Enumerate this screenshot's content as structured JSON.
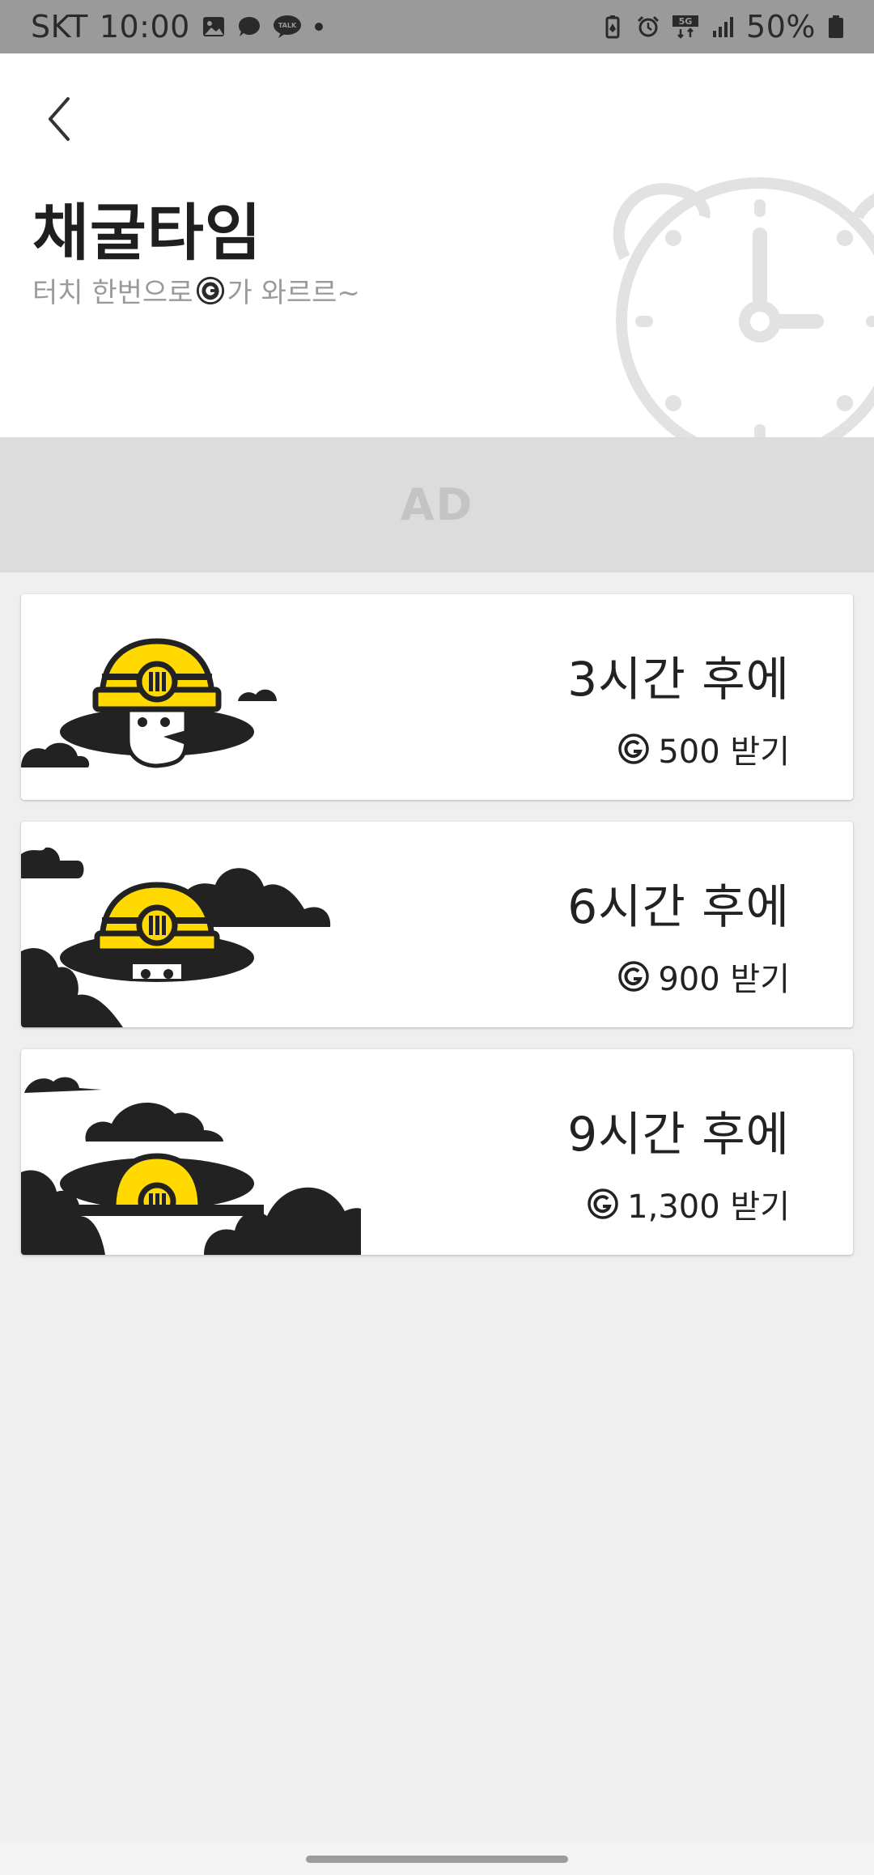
{
  "status_bar": {
    "carrier": "SKT",
    "time": "10:00",
    "battery": "50%",
    "network": "5G",
    "icons_left": [
      "gallery-icon",
      "chat-bubble-icon",
      "kakaotalk-icon",
      "dot-icon"
    ],
    "icons_right": [
      "battery-saver-icon",
      "alarm-icon",
      "5g-icon",
      "signal-icon",
      "battery-icon"
    ]
  },
  "header": {
    "title": "채굴타임",
    "subtitle_before": "터치 한번으로 ",
    "subtitle_after": "가 와르르~",
    "coin_icon": "g-coin-icon",
    "background_icon": "alarm-clock-icon"
  },
  "ad": {
    "label": "AD"
  },
  "cards": [
    {
      "time": "3시간 후에",
      "reward": "500 받기",
      "art": "miner-emerging-icon"
    },
    {
      "time": "6시간 후에",
      "reward": "900 받기",
      "art": "miner-in-hole-icon"
    },
    {
      "time": "9시간 후에",
      "reward": "1,300 받기",
      "art": "miner-deep-icon"
    }
  ],
  "colors": {
    "status_bar": "#9a9a9a",
    "helmet_yellow": "#ffd900",
    "dark": "#222222",
    "ad_bg": "#dcdcdc",
    "page_bg": "#efefef"
  }
}
